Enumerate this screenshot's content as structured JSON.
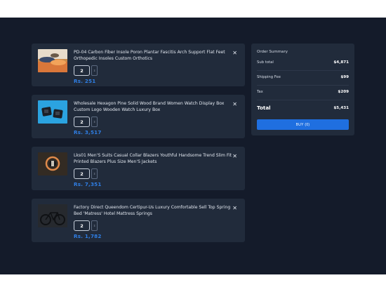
{
  "cart": {
    "items": [
      {
        "title": "PD-04 Carbon Fiber Insole Poron Plantar Fascitis Arch Support Flat Feet Orthopedic Insoles Custom Orthotics",
        "quantity": "2",
        "price": "Rs. 251",
        "image_icon": "insole-product-image"
      },
      {
        "title": "Wholesale Hexagon Pine Solid Wood Brand Women Watch Display Box Custom Logo Wooden Watch Luxury Box",
        "quantity": "2",
        "price": "Rs. 3,517",
        "image_icon": "watch-box-product-image"
      },
      {
        "title": "Lks01 Men'S Suits Casual Collar Blazers Youthful Handsome Trend Slim Fit Printed Blazers Plus Size Men'S Jackets",
        "quantity": "2",
        "price": "Rs. 7,351",
        "image_icon": "blazer-product-image"
      },
      {
        "title": "Factory Direct Queendom Certipur-Us Luxury Comfortable Sell Top Spring Bed 'Matress' Hotel Mattress Springs",
        "quantity": "2",
        "price": "Rs. 1,782",
        "image_icon": "mattress-bike-product-image"
      }
    ],
    "close_icon": "close-icon",
    "stepper_icon": "chevron-up-down-icon"
  },
  "summary": {
    "title": "Order Summary",
    "subtotal_label": "Sub total",
    "subtotal_value": "$4,871",
    "shipping_label": "Shipping Fee",
    "shipping_value": "$99",
    "tax_label": "Tax",
    "tax_value": "$209",
    "total_label": "Total",
    "total_value": "$5,431",
    "buy_label": "BUY (0)"
  },
  "colors": {
    "page_bg": "#141b2a",
    "card_bg": "#212b3b",
    "accent": "#1f6fe0",
    "price": "#2f7fe6"
  }
}
